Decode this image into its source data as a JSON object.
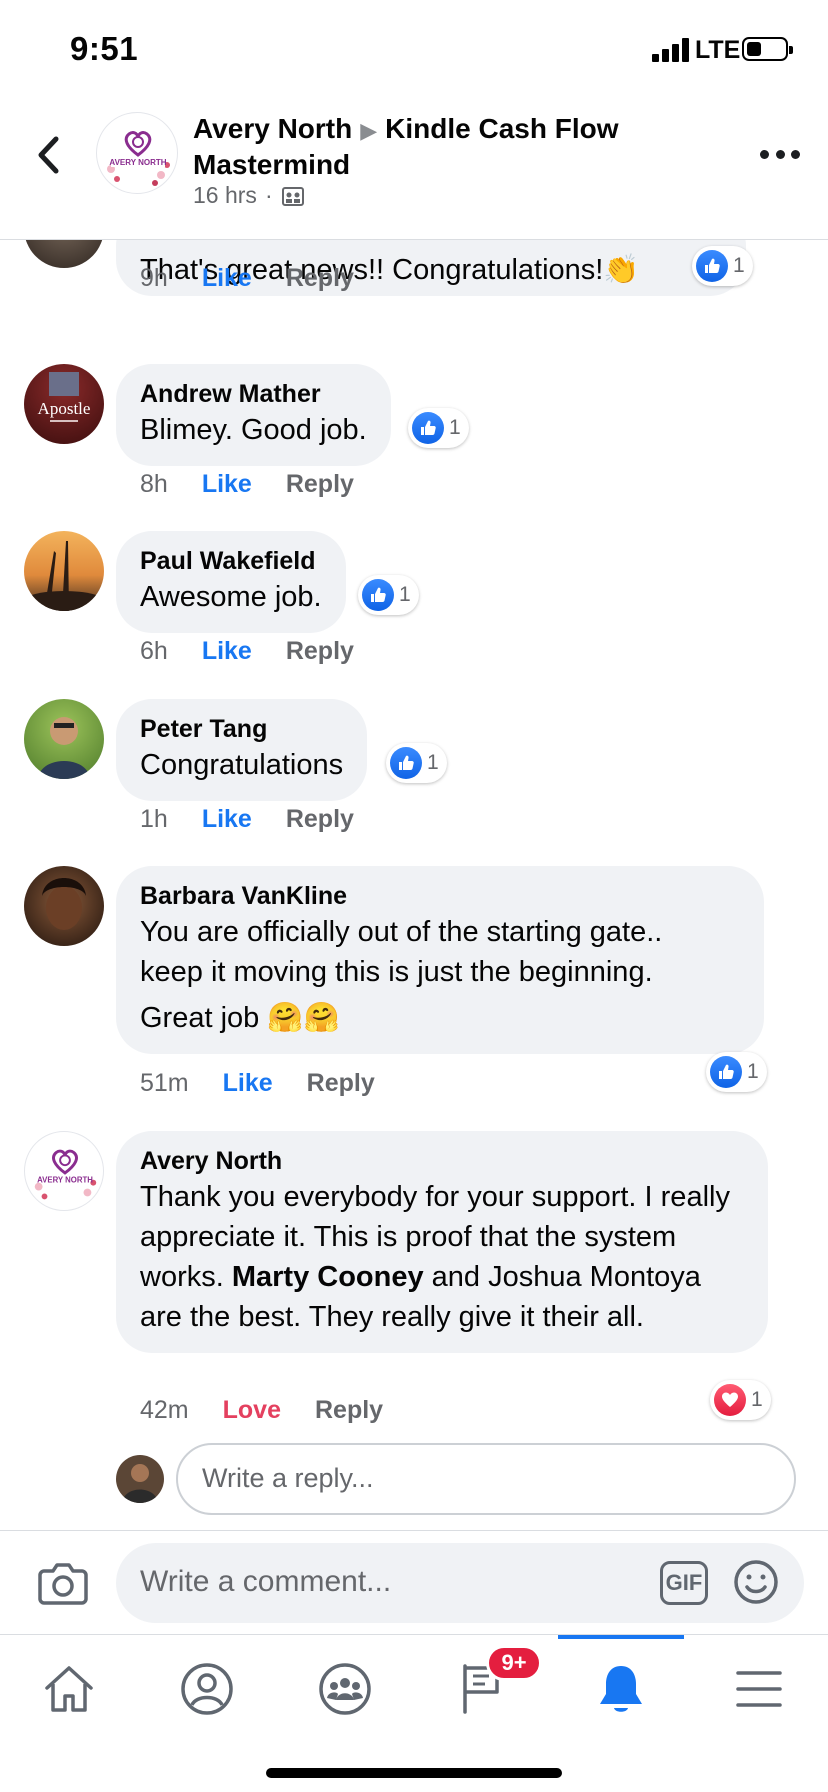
{
  "status_bar": {
    "time": "9:51",
    "network": "LTE"
  },
  "header": {
    "author": "Avery North",
    "group": "Kindle Cash Flow Mastermind",
    "time_ago": "16 hrs",
    "separator": "·",
    "avatar_text": "AVERY NORTH"
  },
  "comments": [
    {
      "author": "",
      "text": "That's  great news!!  Congratulations!👏",
      "time": "9h",
      "action": "Like",
      "reply": "Reply",
      "reaction_count": "1",
      "reaction_type": "like"
    },
    {
      "author": "Andrew Mather",
      "text": "Blimey. Good job.",
      "time": "8h",
      "action": "Like",
      "reply": "Reply",
      "reaction_count": "1",
      "reaction_type": "like",
      "avatar_text": "Apostle"
    },
    {
      "author": "Paul Wakefield",
      "text": "Awesome job.",
      "time": "6h",
      "action": "Like",
      "reply": "Reply",
      "reaction_count": "1",
      "reaction_type": "like"
    },
    {
      "author": "Peter Tang",
      "text": "Congratulations",
      "time": "1h",
      "action": "Like",
      "reply": "Reply",
      "reaction_count": "1",
      "reaction_type": "like"
    },
    {
      "author": "Barbara VanKline",
      "text_line1": "You are officially out of the starting gate..",
      "text_line2": "keep it moving this is just the beginning.",
      "text_line3": "Great job 🤗🤗",
      "time": "51m",
      "action": "Like",
      "reply": "Reply",
      "reaction_count": "1",
      "reaction_type": "like"
    },
    {
      "author": "Avery North",
      "text_before": "Thank you everybody for your support. I really appreciate it. This is proof that the system works. ",
      "mention": "Marty Cooney",
      "text_after": " and Joshua Montoya are the best. They really give it their all.",
      "time": "42m",
      "action": "Love",
      "reply": "Reply",
      "reaction_count": "1",
      "reaction_type": "love",
      "avatar_text": "AVERY NORTH"
    }
  ],
  "reply_box": {
    "placeholder": "Write a reply..."
  },
  "composer": {
    "placeholder": "Write a comment...",
    "gif_label": "GIF"
  },
  "tabbar": {
    "notification_badge": "9+",
    "active_tab": "notifications"
  },
  "colors": {
    "accent": "#1877f2",
    "love": "#e4405f",
    "bubble": "#f0f2f5",
    "badge": "#e41e3f"
  }
}
